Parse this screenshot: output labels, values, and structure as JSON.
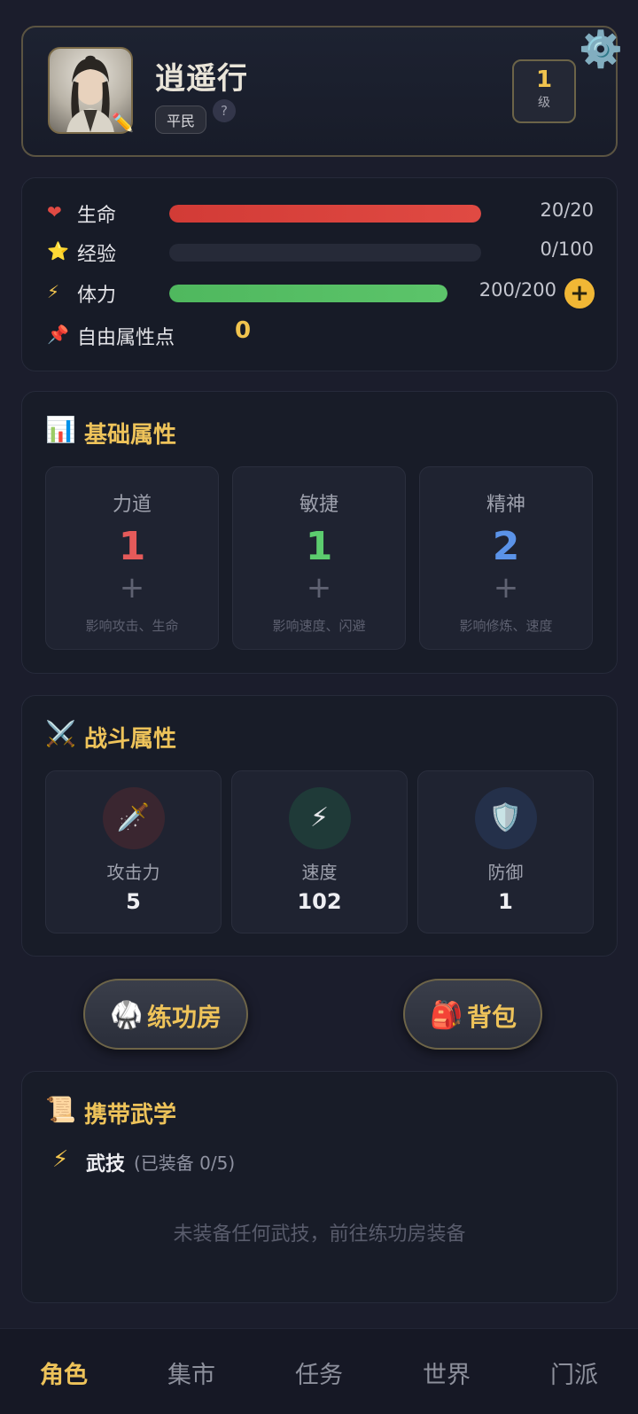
{
  "profile": {
    "name": "逍遥行",
    "rank": "平民",
    "help": "?",
    "level": "1",
    "level_unit": "级"
  },
  "stats": {
    "hp": {
      "label": "生命",
      "value": "20/20",
      "fraction": 1.0,
      "color": "#e04a43"
    },
    "exp": {
      "label": "经验",
      "value": "0/100",
      "fraction": 0.0
    },
    "stamina": {
      "label": "体力",
      "value": "200/200",
      "fraction": 1.0,
      "color": "#5cc46a"
    },
    "free_points": {
      "label": "自由属性点",
      "value": "0"
    }
  },
  "base_attrs": {
    "title": "基础属性",
    "items": [
      {
        "name": "力道",
        "value": "1",
        "plus": "+",
        "desc": "影响攻击、生命",
        "color": "#e55a5a"
      },
      {
        "name": "敏捷",
        "value": "1",
        "plus": "+",
        "desc": "影响速度、闪避",
        "color": "#5ccc6e"
      },
      {
        "name": "精神",
        "value": "2",
        "plus": "+",
        "desc": "影响修炼、速度",
        "color": "#5b93e8"
      }
    ]
  },
  "combat_attrs": {
    "title": "战斗属性",
    "items": [
      {
        "name": "攻击力",
        "value": "5",
        "icon": "🗡️",
        "bg": "#3a2630"
      },
      {
        "name": "速度",
        "value": "102",
        "icon": "⚡",
        "bg": "#1f3a38"
      },
      {
        "name": "防御",
        "value": "1",
        "icon": "🛡️",
        "bg": "#24304a"
      }
    ]
  },
  "buttons": {
    "training": "练功房",
    "backpack": "背包"
  },
  "martial": {
    "title": "携带武学",
    "skill_label": "武技",
    "skill_count": "(已装备 0/5)",
    "empty": "未装备任何武技，前往练功房装备"
  },
  "nav": {
    "items": [
      "角色",
      "集市",
      "任务",
      "世界",
      "门派"
    ],
    "active": 0
  }
}
